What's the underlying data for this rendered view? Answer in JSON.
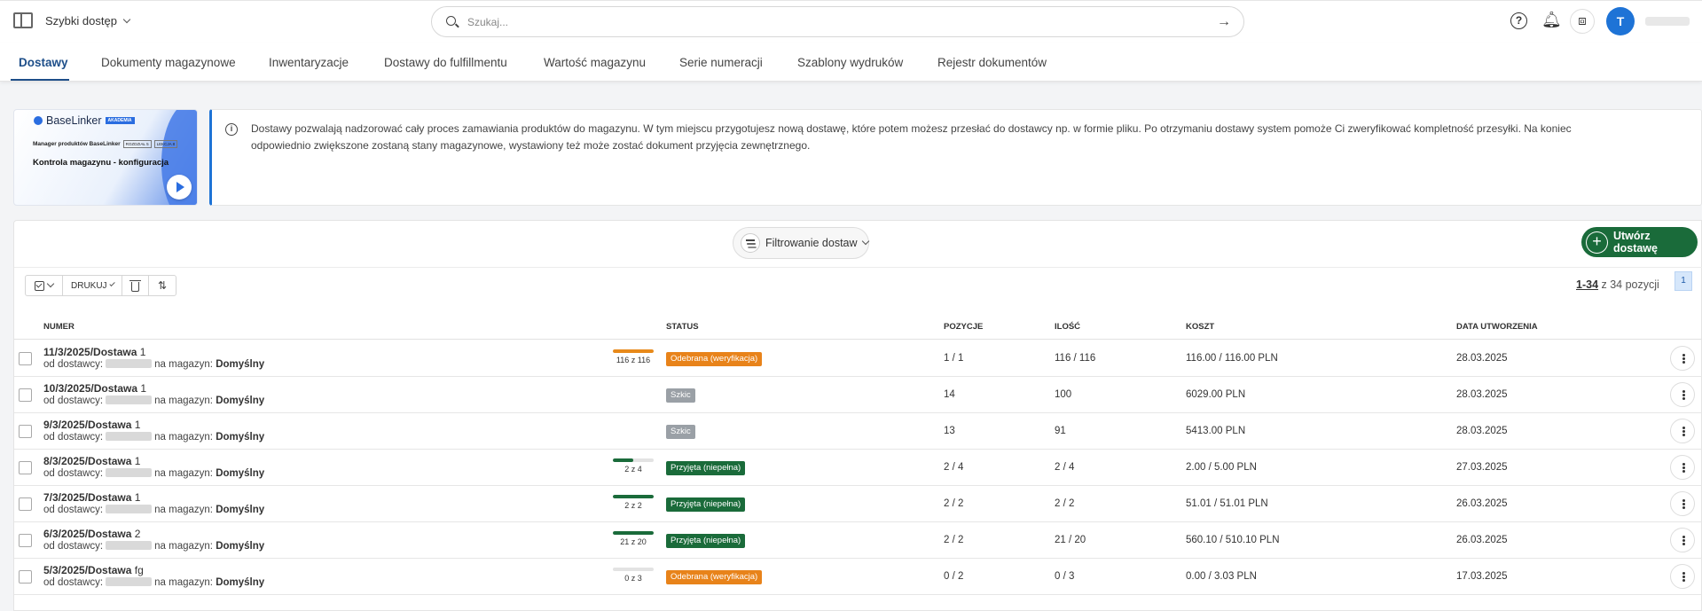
{
  "topbar": {
    "quick_access": "Szybki dostęp",
    "search_placeholder": "Szukaj...",
    "avatar_letter": "T"
  },
  "tabs": [
    {
      "label": "Dostawy",
      "active": true
    },
    {
      "label": "Dokumenty magazynowe"
    },
    {
      "label": "Inwentaryzacje"
    },
    {
      "label": "Dostawy do fulfillmentu"
    },
    {
      "label": "Wartość magazynu"
    },
    {
      "label": "Serie numeracji"
    },
    {
      "label": "Szablony wydruków"
    },
    {
      "label": "Rejestr dokumentów"
    }
  ],
  "promo": {
    "brand": "BaseLinker",
    "badge": "AKADEMIA",
    "subtitle": "Manager produktów BaseLinker",
    "chip1": "ROZDZIAŁ 5",
    "chip2": "LEKCJA 8",
    "title": "Kontrola magazynu - konfiguracja"
  },
  "info": {
    "text": "Dostawy pozwalają nadzorować cały proces zamawiania produktów do magazynu. W tym miejscu przygotujesz nową dostawę, które potem możesz przesłać do dostawcy np. w formie pliku. Po otrzymaniu dostawy system pomoże Ci zweryfikować kompletność przesyłki. Na koniec odpowiednio zwiększone zostaną stany magazynowe, wystawiony też może zostać dokument przyjęcia zewnętrznego."
  },
  "panel": {
    "filter_label": "Filtrowanie dostaw",
    "create_label": "Utwórz dostawę",
    "print_label": "DRUKUJ",
    "pagination_range": "1-34",
    "pagination_suffix": " z 34 pozycji",
    "page": "1"
  },
  "table": {
    "headers": {
      "numer": "NUMER",
      "status": "STATUS",
      "pozycje": "POZYCJE",
      "ilosc": "ILOŚĆ",
      "koszt": "KOSZT",
      "data": "DATA UTWORZENIA"
    },
    "supplier_prefix": "od dostawcy:",
    "warehouse_prefix": "na magazyn:",
    "rows": [
      {
        "number": "11/3/2025/Dostawa",
        "suffix": "1",
        "warehouse": "Domyślny",
        "progress_text": "116 z 116",
        "progress": 1.0,
        "progress_color": "#e88a1a",
        "status": "Odebrana (weryfikacja)",
        "status_color": "#e8831a",
        "positions": "1 / 1",
        "qty": "116 / 116",
        "cost": "116.00 / 116.00 PLN",
        "date": "28.03.2025"
      },
      {
        "number": "10/3/2025/Dostawa",
        "suffix": "1",
        "warehouse": "Domyślny",
        "progress_text": "",
        "progress": null,
        "progress_color": "",
        "status": "Szkic",
        "status_color": "#9aa0a6",
        "positions": "14",
        "qty": "100",
        "cost": "6029.00 PLN",
        "date": "28.03.2025"
      },
      {
        "number": "9/3/2025/Dostawa",
        "suffix": "1",
        "warehouse": "Domyślny",
        "progress_text": "",
        "progress": null,
        "progress_color": "",
        "status": "Szkic",
        "status_color": "#9aa0a6",
        "positions": "13",
        "qty": "91",
        "cost": "5413.00 PLN",
        "date": "28.03.2025"
      },
      {
        "number": "8/3/2025/Dostawa",
        "suffix": "1",
        "warehouse": "Domyślny",
        "progress_text": "2 z 4",
        "progress": 0.5,
        "progress_color": "#1a6b3a",
        "status": "Przyjęta (niepełna)",
        "status_color": "#1a6b3a",
        "positions": "2 / 4",
        "qty": "2 / 4",
        "cost": "2.00 / 5.00 PLN",
        "date": "27.03.2025"
      },
      {
        "number": "7/3/2025/Dostawa",
        "suffix": "1",
        "warehouse": "Domyślny",
        "progress_text": "2 z 2",
        "progress": 1.0,
        "progress_color": "#1a6b3a",
        "status": "Przyjęta (niepełna)",
        "status_color": "#1a6b3a",
        "positions": "2 / 2",
        "qty": "2 / 2",
        "cost": "51.01 / 51.01 PLN",
        "date": "26.03.2025"
      },
      {
        "number": "6/3/2025/Dostawa",
        "suffix": "2",
        "warehouse": "Domyślny",
        "progress_text": "21 z 20",
        "progress": 1.0,
        "progress_color": "#1a6b3a",
        "status": "Przyjęta (niepełna)",
        "status_color": "#1a6b3a",
        "positions": "2 / 2",
        "qty": "21 / 20",
        "cost": "560.10 / 510.10 PLN",
        "date": "26.03.2025"
      },
      {
        "number": "5/3/2025/Dostawa",
        "suffix": "fg",
        "warehouse": "Domyślny",
        "progress_text": "0 z 3",
        "progress": 0.0,
        "progress_color": "#1a6b3a",
        "status": "Odebrana (weryfikacja)",
        "status_color": "#e8831a",
        "positions": "0 / 2",
        "qty": "0 / 3",
        "cost": "0.00 / 3.03 PLN",
        "date": "17.03.2025"
      }
    ]
  }
}
